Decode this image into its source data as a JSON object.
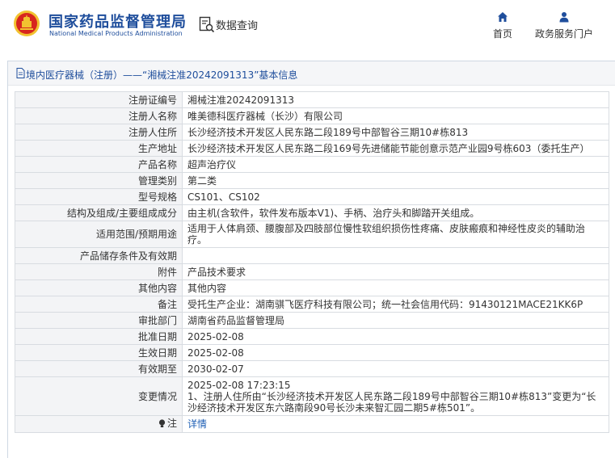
{
  "header": {
    "site_name_cn": "国家药品监督管理局",
    "site_name_en": "National Medical Products Administration",
    "query_label": "数据查询",
    "nav": [
      {
        "label": "首页",
        "icon": "home-icon"
      },
      {
        "label": "政务服务门户",
        "icon": "user-icon"
      }
    ]
  },
  "panel": {
    "title": "境内医疗器械（注册）——“湘械注准20242091313”基本信息"
  },
  "rows": [
    {
      "label": "注册证编号",
      "value": "湘械注准20242091313"
    },
    {
      "label": "注册人名称",
      "value": "唯美德科医疗器械（长沙）有限公司"
    },
    {
      "label": "注册人住所",
      "value": "长沙经济技术开发区人民东路二段189号中部智谷三期10#栋813"
    },
    {
      "label": "生产地址",
      "value": "长沙经济技术开发区人民东路二段169号先进储能节能创意示范产业园9号栋603（委托生产）"
    },
    {
      "label": "产品名称",
      "value": "超声治疗仪"
    },
    {
      "label": "管理类别",
      "value": "第二类"
    },
    {
      "label": "型号规格",
      "value": "CS101、CS102"
    },
    {
      "label": "结构及组成/主要组成成分",
      "value": "由主机(含软件，软件发布版本V1)、手柄、治疗头和脚踏开关组成。"
    },
    {
      "label": "适用范围/预期用途",
      "value": "适用于人体肩颈、腰腹部及四肢部位慢性软组织损伤性疼痛、皮肤瘢痕和神经性皮炎的辅助治疗。"
    },
    {
      "label": "产品储存条件及有效期",
      "value": ""
    },
    {
      "label": "附件",
      "value": "产品技术要求"
    },
    {
      "label": "其他内容",
      "value": "其他内容"
    },
    {
      "label": "备注",
      "value": "受托生产企业：湖南骐飞医疗科技有限公司；统一社会信用代码：91430121MACE21KK6P"
    },
    {
      "label": "审批部门",
      "value": "湖南省药品监督管理局"
    },
    {
      "label": "批准日期",
      "value": "2025-02-08"
    },
    {
      "label": "生效日期",
      "value": "2025-02-08"
    },
    {
      "label": "有效期至",
      "value": "2030-02-07"
    },
    {
      "label": "变更情况",
      "value_time": "2025-02-08 17:23:15",
      "value": "1、注册人住所由“长沙经济技术开发区人民东路二段189号中部智谷三期10#栋813”变更为“长沙经济技术开发区东六路南段90号长沙未来智汇园二期5#栋501”。"
    },
    {
      "label": "注",
      "value": "详情",
      "icon": "bulb-icon"
    }
  ],
  "colors": {
    "brand_blue": "#1f4e9c",
    "link_blue": "#1f5fb5",
    "label_bg": "#f3f4f6",
    "border": "#d8dce1",
    "logo_red": "#d7261e",
    "logo_gold": "#f2c230"
  }
}
